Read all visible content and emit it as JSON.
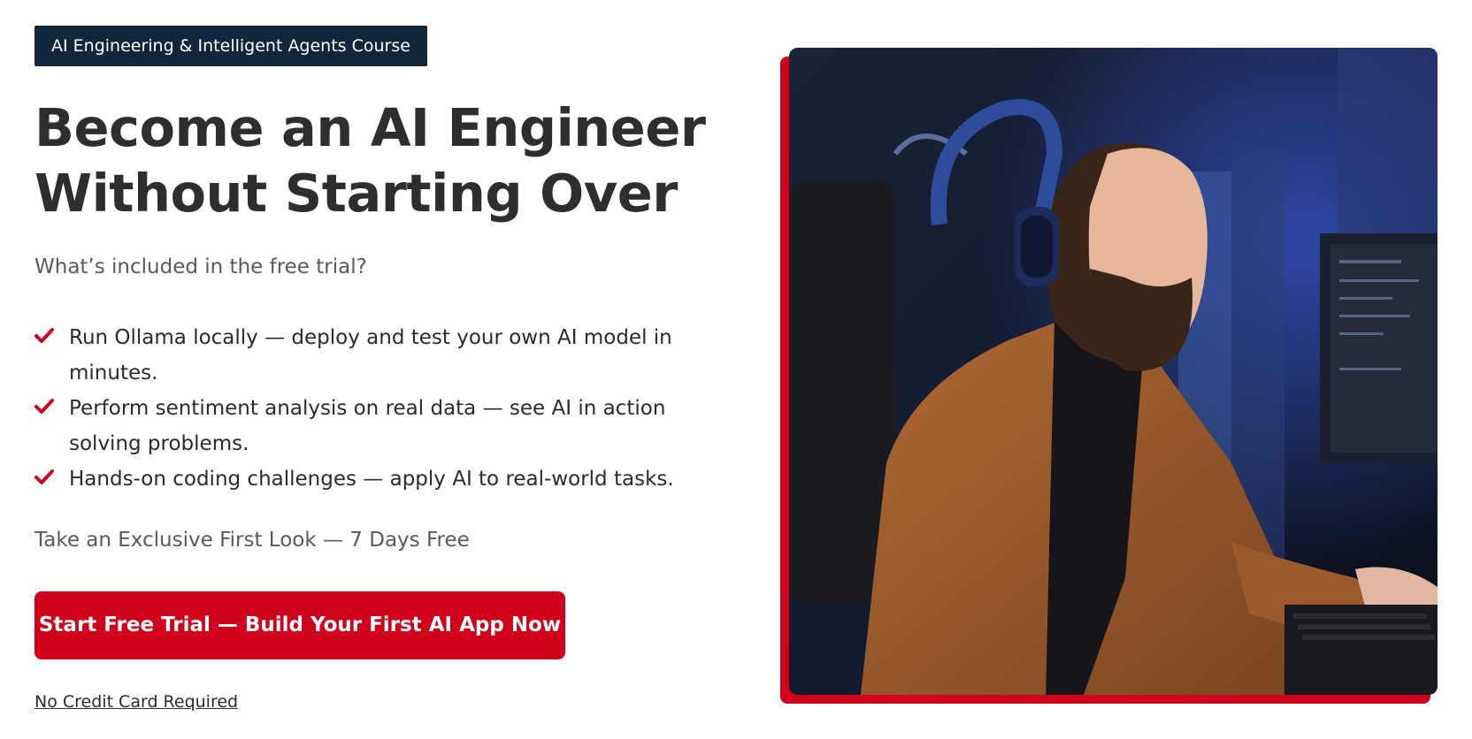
{
  "badge": {
    "label": "AI Engineering & Intelligent Agents Course"
  },
  "headline": {
    "line1": "Become an AI Engineer",
    "line2": "Without Starting Over"
  },
  "subheading": "What’s included in the free trial?",
  "features": [
    {
      "icon": "check-icon",
      "text": "Run Ollama locally — deploy and test your own AI model in minutes."
    },
    {
      "icon": "check-icon",
      "text": "Perform sentiment analysis on real data — see AI in action solving problems."
    },
    {
      "icon": "check-icon",
      "text": "Hands-on coding challenges — apply AI to real-world tasks."
    }
  ],
  "tagline": "Take an Exclusive First Look — 7 Days Free",
  "cta": {
    "label": "Start Free Trial — Build Your First AI App Now"
  },
  "no_credit_card": "No Credit Card Required",
  "hero_image": {
    "description_icon": "man-with-headphones-coding-photo"
  },
  "colors": {
    "accent": "#d0021b",
    "badge_bg": "#10263a",
    "text": "#2b2b2b",
    "muted": "#5a5a5a"
  }
}
